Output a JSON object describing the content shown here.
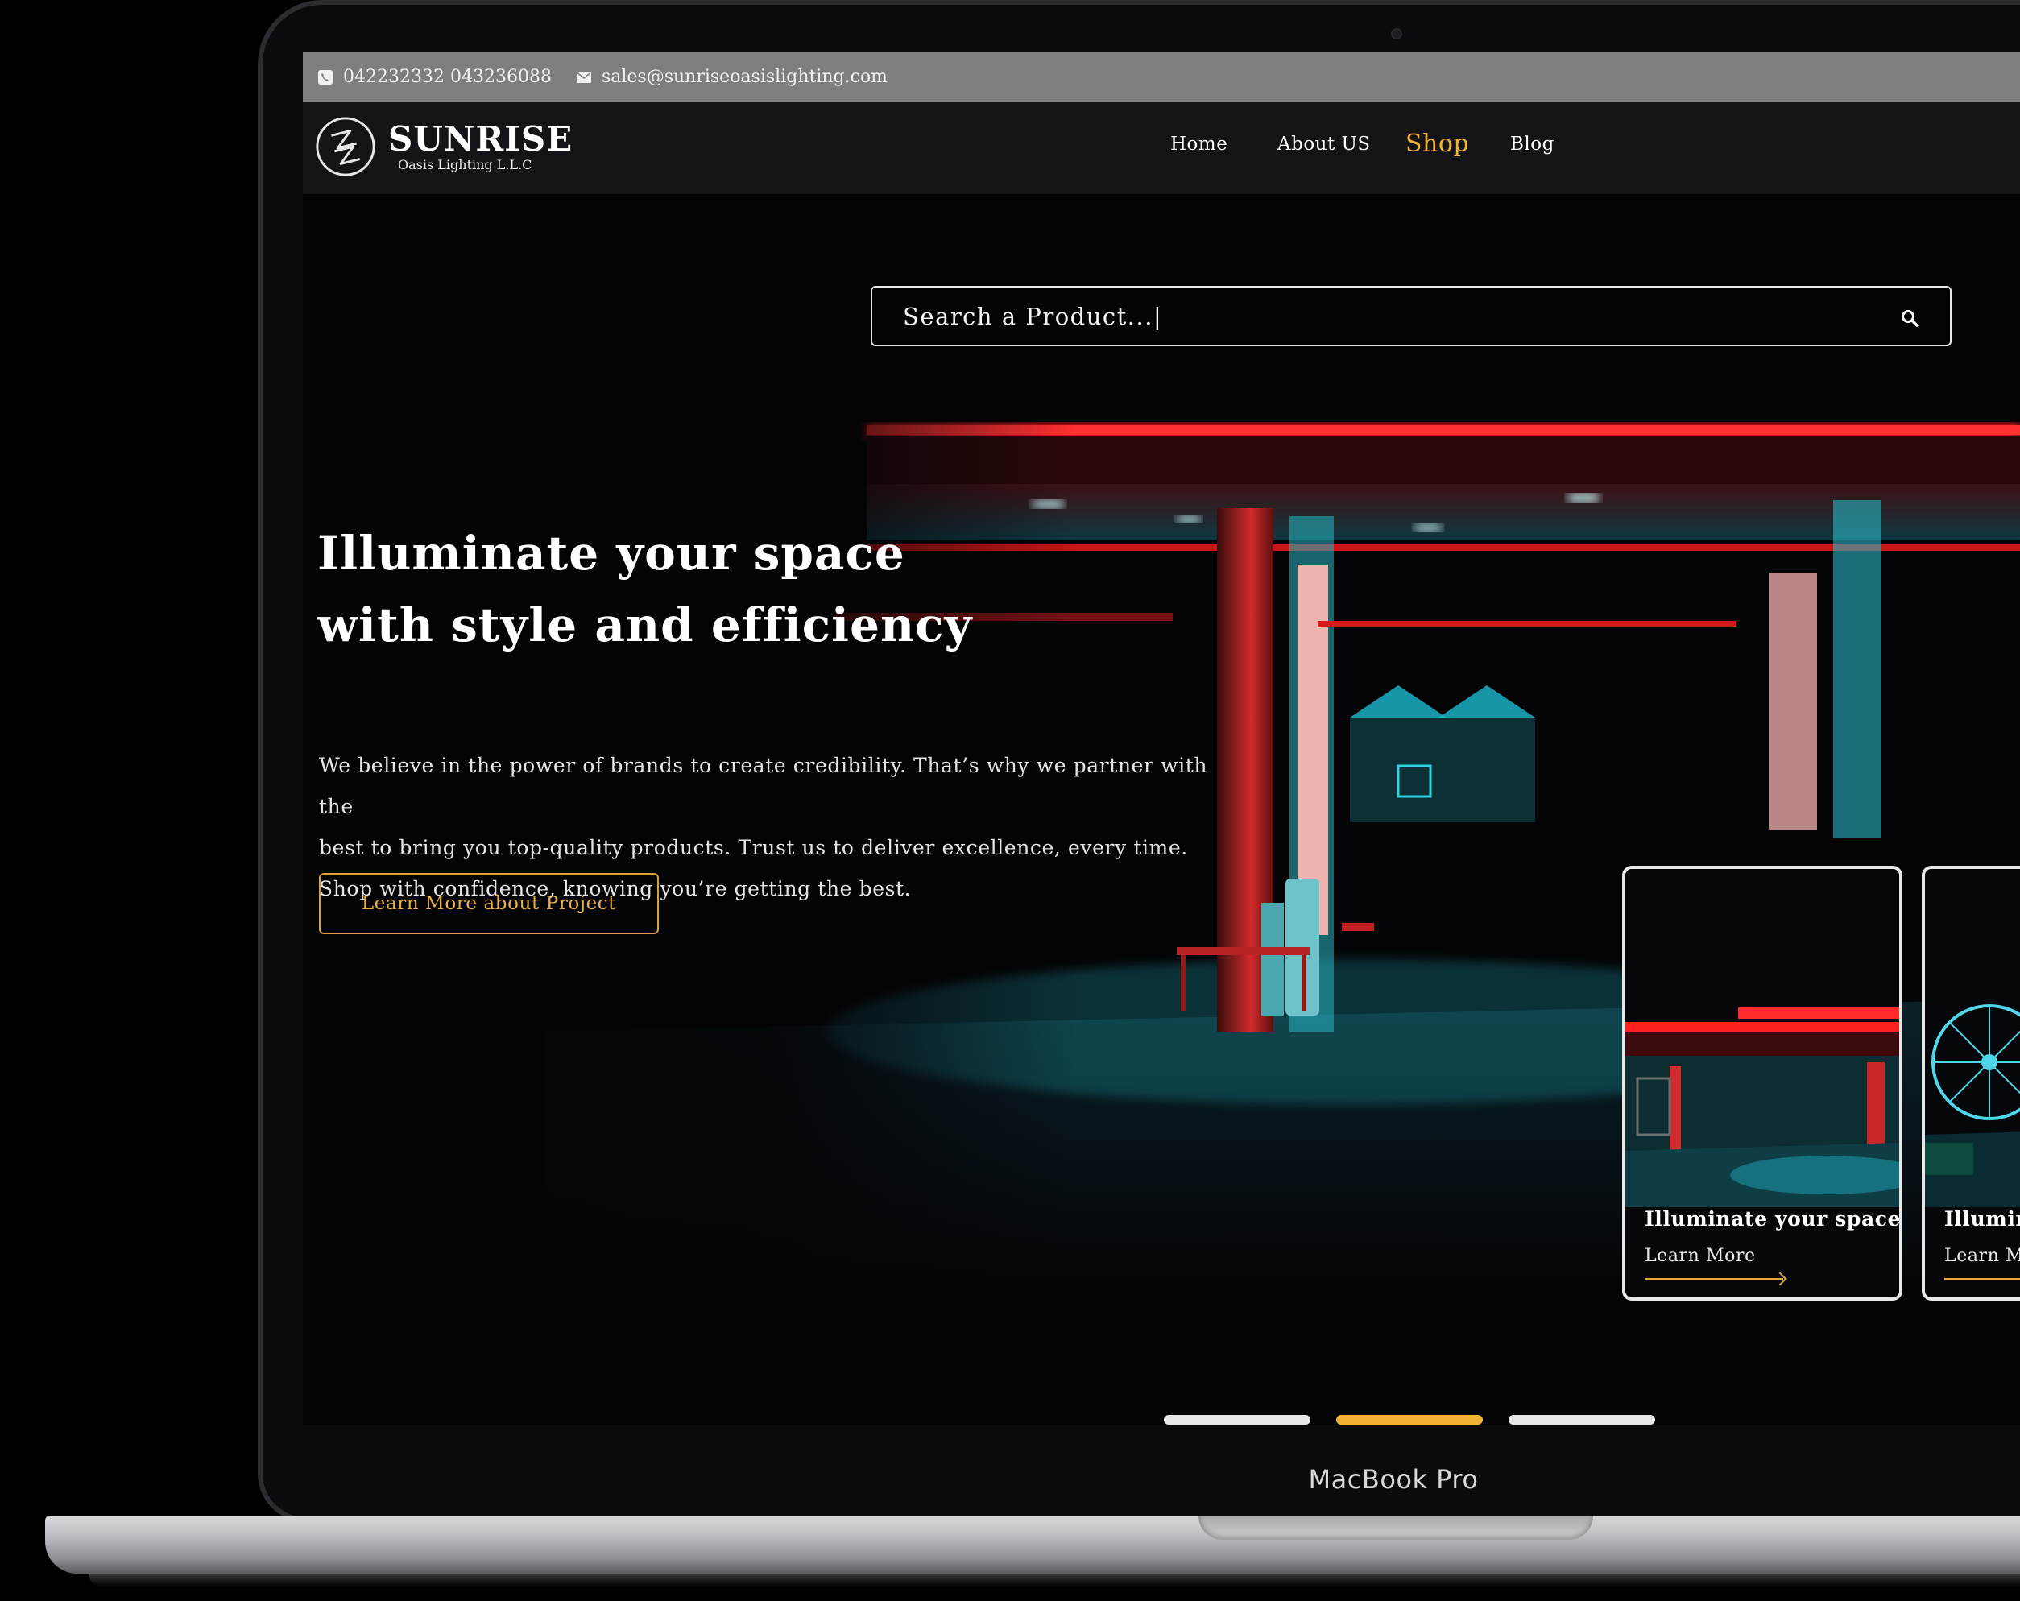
{
  "topbar": {
    "phone": "042232332 043236088",
    "email": "sales@sunriseoasislighting.com"
  },
  "logo": {
    "brand": "SUNRISE",
    "subtitle": "Oasis Lighting L.L.C"
  },
  "nav": {
    "items": [
      {
        "label": "Home",
        "active": false
      },
      {
        "label": "About US",
        "active": false
      },
      {
        "label": "Shop",
        "active": true
      },
      {
        "label": "Blog",
        "active": false
      }
    ]
  },
  "search": {
    "placeholder": "Search a Product...|"
  },
  "hero": {
    "headline_line1": "Illuminate your space",
    "headline_line2": "with style and efficiency",
    "description_line1": "We believe in the power of brands to create credibility. That’s why we partner with the",
    "description_line2": "best to bring you top-quality products. Trust us to deliver excellence, every time.",
    "description_line3": "Shop with confidence, knowing you’re getting the best.",
    "cta_label": "Learn More about Project"
  },
  "cards": [
    {
      "title": "Illuminate your space",
      "link": "Learn More"
    },
    {
      "title": "Illuminate your space",
      "link": "Learn More"
    }
  ],
  "carousel": {
    "slide_count": 3,
    "active_index": 1
  },
  "device": {
    "label": "MacBook Pro"
  },
  "colors": {
    "accent": "#f2b233",
    "topbar_bg": "#7e7e82",
    "header_bg": "#141418",
    "neon_red": "#ff1a1a",
    "neon_cyan": "#23c4d4"
  },
  "icons": {
    "phone": "phone-icon",
    "email": "envelope-icon",
    "search": "search-icon",
    "logo": "sunrise-logo-icon"
  }
}
